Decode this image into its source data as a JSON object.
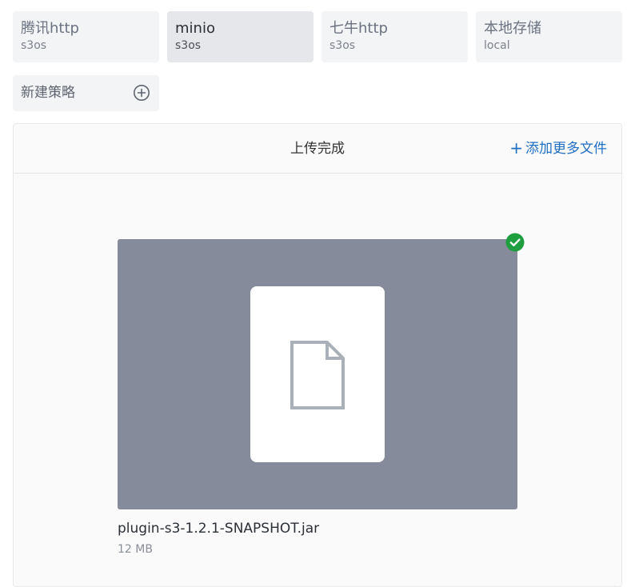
{
  "policies": [
    {
      "name": "腾讯http",
      "type": "s3os",
      "selected": false
    },
    {
      "name": "minio",
      "type": "s3os",
      "selected": true
    },
    {
      "name": "七牛http",
      "type": "s3os",
      "selected": false
    },
    {
      "name": "本地存储",
      "type": "local",
      "selected": false
    }
  ],
  "new_policy": {
    "label": "新建策略",
    "icon": "plus-circle-icon"
  },
  "upload": {
    "title": "上传完成",
    "add_more_label": "添加更多文件",
    "add_more_icon": "plus-icon",
    "file": {
      "name": "plugin-s3-1.2.1-SNAPSHOT.jar",
      "size": "12 MB",
      "icon": "document-icon",
      "status_icon": "check-circle-icon",
      "status_color": "#1e9e3e"
    }
  },
  "colors": {
    "accent": "#1f6fc5",
    "preview_bg": "#858b9a",
    "card_bg": "#f3f4f6",
    "card_selected_bg": "#e6e7eb"
  }
}
